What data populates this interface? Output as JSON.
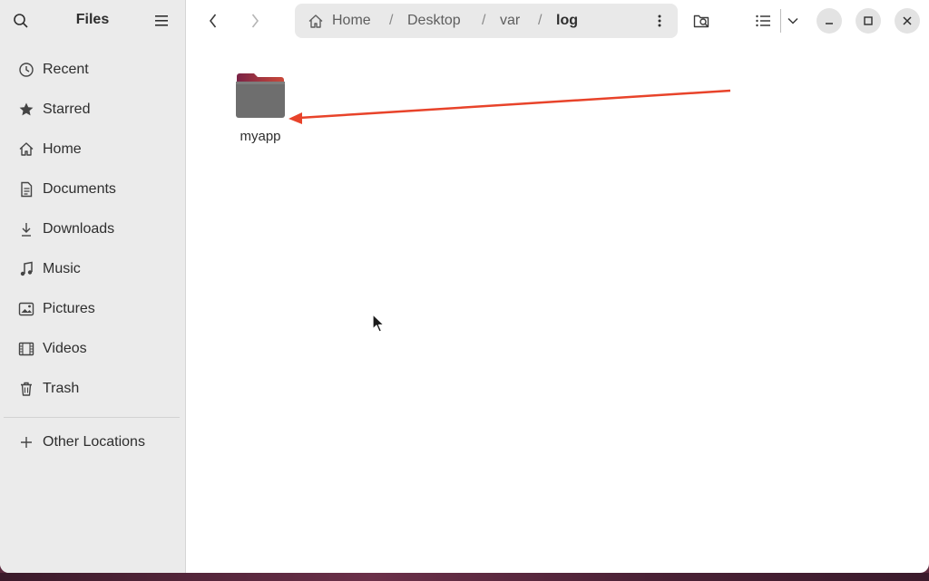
{
  "sidebar": {
    "title": "Files",
    "items": [
      {
        "label": "Recent",
        "icon": "clock-icon"
      },
      {
        "label": "Starred",
        "icon": "star-icon"
      },
      {
        "label": "Home",
        "icon": "home-icon"
      },
      {
        "label": "Documents",
        "icon": "document-icon"
      },
      {
        "label": "Downloads",
        "icon": "download-icon"
      },
      {
        "label": "Music",
        "icon": "music-icon"
      },
      {
        "label": "Pictures",
        "icon": "picture-icon"
      },
      {
        "label": "Videos",
        "icon": "video-icon"
      },
      {
        "label": "Trash",
        "icon": "trash-icon"
      }
    ],
    "other_locations": "Other Locations"
  },
  "pathbar": {
    "crumbs": [
      "Home",
      "Desktop",
      "var",
      "log"
    ],
    "separator": "/"
  },
  "content": {
    "items": [
      {
        "label": "myapp",
        "type": "folder"
      }
    ]
  },
  "colors": {
    "accent_arrow": "#e8432a",
    "sidebar_bg": "#ebebeb",
    "folder_top": "#8d2a4d",
    "folder_body": "#6d6d6d"
  }
}
